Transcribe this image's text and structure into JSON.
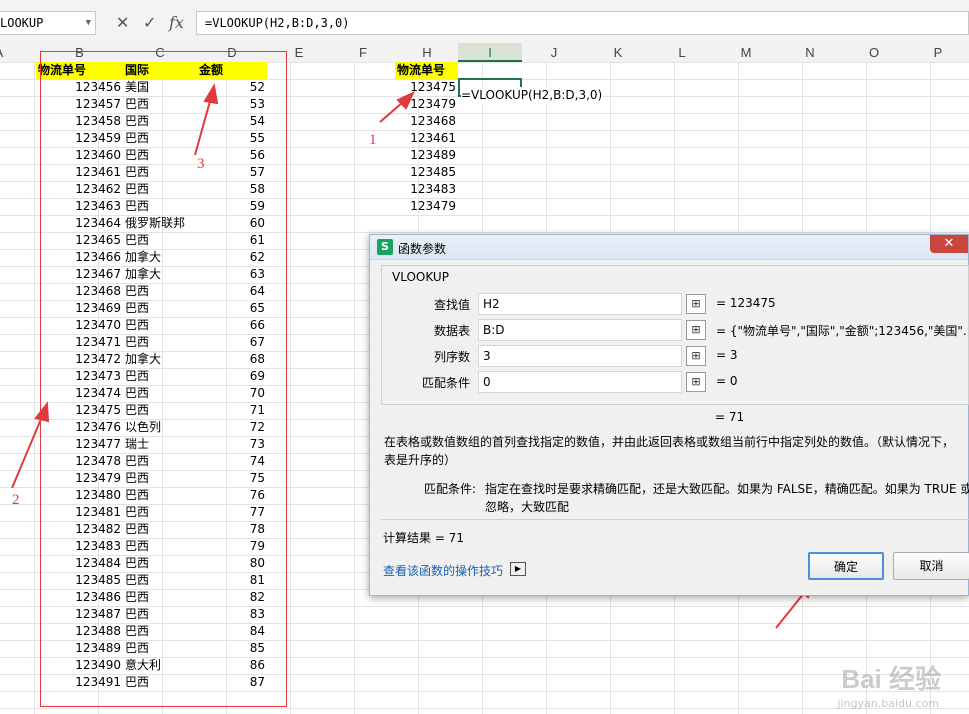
{
  "formula_bar": {
    "name_box": "LOOKUP",
    "cancel_icon": "✕",
    "confirm_icon": "✓",
    "fx_label": "fx",
    "formula": "=VLOOKUP(H2,B:D,3,0)"
  },
  "columns": [
    "A",
    "B",
    "C",
    "D",
    "E",
    "F",
    "G",
    "H",
    "I",
    "J",
    "K",
    "L",
    "M",
    "N",
    "O",
    "P"
  ],
  "active_column": "I",
  "table_left": {
    "headers": [
      "物流单号",
      "国际",
      "金额"
    ],
    "rows": [
      [
        "123456",
        "美国",
        "52"
      ],
      [
        "123457",
        "巴西",
        "53"
      ],
      [
        "123458",
        "巴西",
        "54"
      ],
      [
        "123459",
        "巴西",
        "55"
      ],
      [
        "123460",
        "巴西",
        "56"
      ],
      [
        "123461",
        "巴西",
        "57"
      ],
      [
        "123462",
        "巴西",
        "58"
      ],
      [
        "123463",
        "巴西",
        "59"
      ],
      [
        "123464",
        "俄罗斯联邦",
        "60"
      ],
      [
        "123465",
        "巴西",
        "61"
      ],
      [
        "123466",
        "加拿大",
        "62"
      ],
      [
        "123467",
        "加拿大",
        "63"
      ],
      [
        "123468",
        "巴西",
        "64"
      ],
      [
        "123469",
        "巴西",
        "65"
      ],
      [
        "123470",
        "巴西",
        "66"
      ],
      [
        "123471",
        "巴西",
        "67"
      ],
      [
        "123472",
        "加拿大",
        "68"
      ],
      [
        "123473",
        "巴西",
        "69"
      ],
      [
        "123474",
        "巴西",
        "70"
      ],
      [
        "123475",
        "巴西",
        "71"
      ],
      [
        "123476",
        "以色列",
        "72"
      ],
      [
        "123477",
        "瑞士",
        "73"
      ],
      [
        "123478",
        "巴西",
        "74"
      ],
      [
        "123479",
        "巴西",
        "75"
      ],
      [
        "123480",
        "巴西",
        "76"
      ],
      [
        "123481",
        "巴西",
        "77"
      ],
      [
        "123482",
        "巴西",
        "78"
      ],
      [
        "123483",
        "巴西",
        "79"
      ],
      [
        "123484",
        "巴西",
        "80"
      ],
      [
        "123485",
        "巴西",
        "81"
      ],
      [
        "123486",
        "巴西",
        "82"
      ],
      [
        "123487",
        "巴西",
        "83"
      ],
      [
        "123488",
        "巴西",
        "84"
      ],
      [
        "123489",
        "巴西",
        "85"
      ],
      [
        "123490",
        "意大利",
        "86"
      ],
      [
        "123491",
        "巴西",
        "87"
      ]
    ]
  },
  "table_right": {
    "header": "物流单号",
    "values": [
      "123475",
      "123479",
      "123468",
      "123461",
      "123489",
      "123485",
      "123483",
      "123479"
    ],
    "active_cell_formula": "=VLOOKUP(H2,B:D,3,0)"
  },
  "annotations": [
    "1",
    "2",
    "3"
  ],
  "dialog": {
    "title": "函数参数",
    "logo": "S",
    "close_icon": "✕",
    "group_title": "VLOOKUP",
    "fields": [
      {
        "label": "查找值",
        "value": "H2",
        "result": "=  123475"
      },
      {
        "label": "数据表",
        "value": "B:D",
        "result": "=  {\"物流单号\",\"国际\",\"金额\";123456,\"美国\"..."
      },
      {
        "label": "列序数",
        "value": "3",
        "result": "=  3"
      },
      {
        "label": "匹配条件",
        "value": "0",
        "result": "=  0"
      }
    ],
    "ref_icon": "⊞",
    "overall_result": "=  71",
    "description": "在表格或数值数组的首列查找指定的数值，并由此返回表格或数组当前行中指定列处的数值。（默认情况下，表是升序的）",
    "param_label": "匹配条件:",
    "param_desc_1": "指定在查找时是要求精确匹配，还是大致匹配。如果为 FALSE，精确匹配。如果为 TRUE 或",
    "param_desc_2": "忽略，大致匹配",
    "calc_result": "计算结果  =  71",
    "help_link": "查看该函数的操作技巧",
    "ok_label": "确定",
    "cancel_label": "取消"
  },
  "watermark": {
    "text": "Bai 经验",
    "url": "jingyan.baidu.com"
  }
}
